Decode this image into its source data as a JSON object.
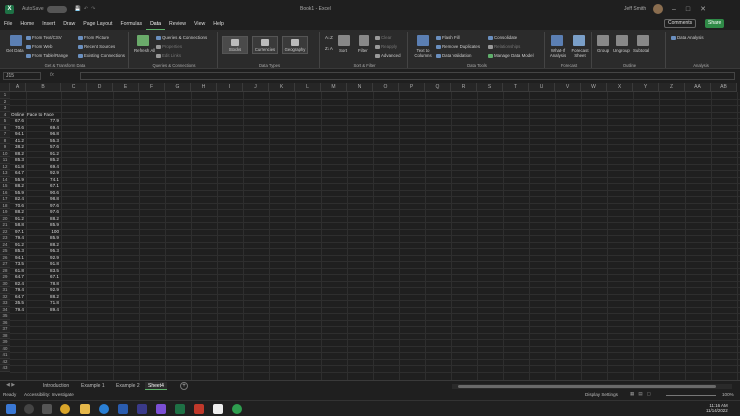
{
  "titlebar": {
    "autosave": "AutoSave",
    "autosave_state": "Off",
    "doc_title": "Book1 - Excel",
    "user": "Jeff Smith",
    "app_letter": "X"
  },
  "menu": {
    "items": [
      "File",
      "Home",
      "Insert",
      "Draw",
      "Page Layout",
      "Formulas",
      "Data",
      "Review",
      "View",
      "Help"
    ],
    "active": "Data",
    "comments": "Comments",
    "share": "Share"
  },
  "ribbon": {
    "get_data": "Get Data",
    "from_text_csv": "From Text/CSV",
    "from_web": "From Web",
    "from_table_range": "From Table/Range",
    "from_picture": "From Picture",
    "recent_sources": "Recent Sources",
    "existing_connections": "Existing Connections",
    "group_get_transform": "Get & Transform Data",
    "refresh_all": "Refresh All",
    "queries_connections": "Queries & Connections",
    "properties": "Properties",
    "edit_links": "Edit Links",
    "group_queries": "Queries & Connections",
    "stocks": "Stocks",
    "currencies": "Currencies",
    "geography": "Geography",
    "group_data_types": "Data Types",
    "sort_az": "A↓Z",
    "sort_za": "Z↓A",
    "sort": "Sort",
    "filter": "Filter",
    "clear": "Clear",
    "reapply": "Reapply",
    "advanced": "Advanced",
    "group_sort_filter": "Sort & Filter",
    "text_to_columns": "Text to Columns",
    "flash_fill": "Flash Fill",
    "remove_duplicates": "Remove Duplicates",
    "data_validation": "Data Validation",
    "consolidate": "Consolidate",
    "relationships": "Relationships",
    "manage_data_model": "Manage Data Model",
    "group_data_tools": "Data Tools",
    "what_if": "What-If Analysis",
    "forecast_sheet": "Forecast Sheet",
    "group_forecast": "Forecast",
    "group": "Group",
    "ungroup": "Ungroup",
    "subtotal": "Subtotal",
    "group_outline": "Outline",
    "data_analysis": "Data Analysis",
    "group_analysis": "Analysis"
  },
  "formula_bar": {
    "name_box": "J15",
    "fx": "fx",
    "value": ""
  },
  "columns": [
    "A",
    "B",
    "C",
    "D",
    "E",
    "F",
    "G",
    "H",
    "I",
    "J",
    "K",
    "L",
    "M",
    "N",
    "O",
    "P",
    "Q",
    "R",
    "S",
    "T",
    "U",
    "V",
    "W",
    "X",
    "Y",
    "Z",
    "AA",
    "AB"
  ],
  "rows": [
    "1",
    "2",
    "3",
    "4",
    "5",
    "6",
    "7",
    "8",
    "9",
    "10",
    "11",
    "12",
    "13",
    "14",
    "15",
    "16",
    "17",
    "18",
    "19",
    "20",
    "21",
    "22",
    "23",
    "24",
    "25",
    "26",
    "27",
    "28",
    "29",
    "30",
    "31",
    "32",
    "33",
    "34",
    "35",
    "36",
    "37",
    "38",
    "39",
    "40",
    "41",
    "42",
    "43"
  ],
  "headers": {
    "a": "Online",
    "b": "Face to Face"
  },
  "data": [
    [
      "67.6",
      "77.9"
    ],
    [
      "70.6",
      "69.4"
    ],
    [
      "94.1",
      "96.8"
    ],
    [
      "41.2",
      "55.3"
    ],
    [
      "38.2",
      "57.6"
    ],
    [
      "88.2",
      "91.2"
    ],
    [
      "85.3",
      "85.2"
    ],
    [
      "61.8",
      "69.4"
    ],
    [
      "64.7",
      "92.9"
    ],
    [
      "55.9",
      "74.1"
    ],
    [
      "88.2",
      "67.1"
    ],
    [
      "55.9",
      "90.6"
    ],
    [
      "82.4",
      "98.8"
    ],
    [
      "70.6",
      "97.6"
    ],
    [
      "88.2",
      "97.6"
    ],
    [
      "91.2",
      "88.2"
    ],
    [
      "58.8",
      "85.9"
    ],
    [
      "97.1",
      "100"
    ],
    [
      "79.4",
      "85.9"
    ],
    [
      "91.2",
      "88.2"
    ],
    [
      "85.3",
      "95.3"
    ],
    [
      "94.1",
      "92.9"
    ],
    [
      "73.5",
      "91.8"
    ],
    [
      "61.8",
      "83.5"
    ],
    [
      "64.7",
      "67.1"
    ],
    [
      "82.4",
      "78.8"
    ],
    [
      "79.4",
      "92.9"
    ],
    [
      "64.7",
      "88.2"
    ],
    [
      "35.5",
      "71.8"
    ],
    [
      "79.4",
      "89.4"
    ]
  ],
  "sheets": [
    "Introduction",
    "Example 1",
    "Example 2",
    "Sheet4"
  ],
  "active_sheet": "Sheet4",
  "status": {
    "ready": "Ready",
    "accessibility": "Accessibility: Investigate",
    "display_settings": "Display Settings",
    "zoom": "100%"
  },
  "taskbar": {
    "time": "11:16 AM",
    "date": "11/14/2022"
  }
}
